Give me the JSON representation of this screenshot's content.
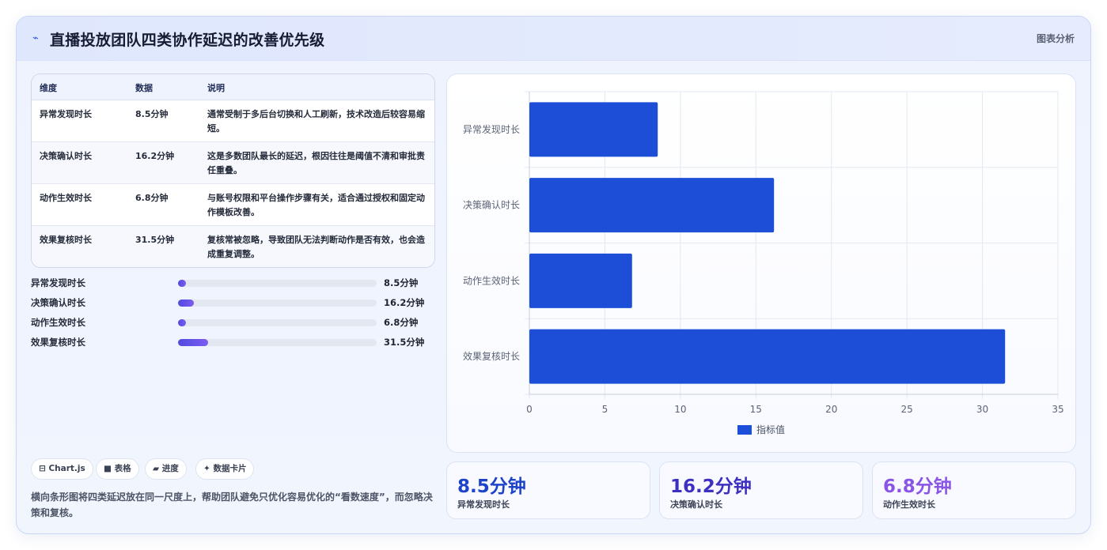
{
  "header": {
    "title": "直播投放团队四类协作延迟的改善优先级",
    "tag": "图表分析"
  },
  "table": {
    "headers": [
      "维度",
      "数据",
      "说明"
    ],
    "rows": [
      {
        "dim": "异常发现时长",
        "value": "8.5分钟",
        "desc": "通常受制于多后台切换和人工刷新，技术改造后较容易缩短。"
      },
      {
        "dim": "决策确认时长",
        "value": "16.2分钟",
        "desc": "这是多数团队最长的延迟，根因往往是阈值不清和审批责任重叠。"
      },
      {
        "dim": "动作生效时长",
        "value": "6.8分钟",
        "desc": "与账号权限和平台操作步骤有关，适合通过授权和固定动作模板改善。"
      },
      {
        "dim": "效果复核时长",
        "value": "31.5分钟",
        "desc": "复核常被忽略，导致团队无法判断动作是否有效，也会造成重复调整。"
      }
    ]
  },
  "progress": [
    {
      "label": "异常发现时长",
      "value_text": "8.5分钟",
      "fraction": 0.04
    },
    {
      "label": "决策确认时长",
      "value_text": "16.2分钟",
      "fraction": 0.08
    },
    {
      "label": "动作生效时长",
      "value_text": "6.8分钟",
      "fraction": 0.04
    },
    {
      "label": "效果复核时长",
      "value_text": "31.5分钟",
      "fraction": 0.15
    }
  ],
  "tags": [
    "⊟ Chart.js",
    "■ 表格",
    "▰ 进度",
    "✦ 数据卡片"
  ],
  "note": "横向条形图将四类延迟放在同一尺度上，帮助团队避免只优化容易优化的“看数速度”，而忽略决策和复核。",
  "stats": [
    {
      "value": "8.5分钟",
      "label": "异常发现时长",
      "color": "#1d44c8"
    },
    {
      "value": "16.2分钟",
      "label": "决策确认时长",
      "color": "#3d2fc2"
    },
    {
      "value": "6.8分钟",
      "label": "动作生效时长",
      "color": "#8a55e6"
    }
  ],
  "chart_data": {
    "type": "bar",
    "orientation": "horizontal",
    "categories": [
      "异常发现时长",
      "决策确认时长",
      "动作生效时长",
      "效果复核时长"
    ],
    "series": [
      {
        "name": "指标值",
        "values": [
          8.5,
          16.2,
          6.8,
          31.5
        ],
        "color": "#1d4ed8"
      }
    ],
    "xlim": [
      0,
      35
    ],
    "xticks": [
      0,
      5,
      10,
      15,
      20,
      25,
      30,
      35
    ],
    "grid": true,
    "legend": "bottom"
  }
}
